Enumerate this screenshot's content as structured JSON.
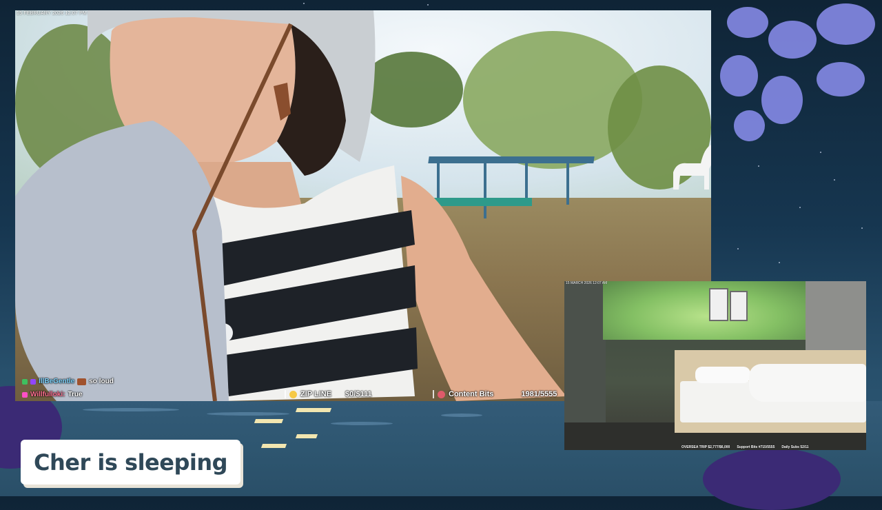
{
  "main_cam": {
    "timestamp": "15 FEBRUARY 2026 12:07 PM"
  },
  "chat": [
    {
      "user": "IllBeGentle",
      "message": "so loud",
      "user_color": "#7dd3fc"
    },
    {
      "user": "Willfulloki:",
      "message": "True",
      "user_color": "#ff6f91"
    }
  ],
  "goals": [
    {
      "label": "ZIP LINE",
      "value": "$0/$111",
      "icon": "scream-emoji-icon"
    },
    {
      "label": "Content Bits",
      "value": "1981/5555",
      "icon": "heart-icon"
    }
  ],
  "bed_cam": {
    "timestamp": "15 MARCH 2026 12:07 AM",
    "goals": [
      {
        "label": "OVERSEA TRIP",
        "value": "$2,777/$6,000"
      },
      {
        "label": "Support Bits",
        "value": "#715/5555"
      },
      {
        "label": "Daily Subs",
        "value": "52/11"
      }
    ]
  },
  "status": {
    "text": "Cher is sleeping"
  },
  "colors": {
    "card_text": "#2f4858",
    "background_night": "#163650",
    "flower": "#8c8ff0"
  }
}
